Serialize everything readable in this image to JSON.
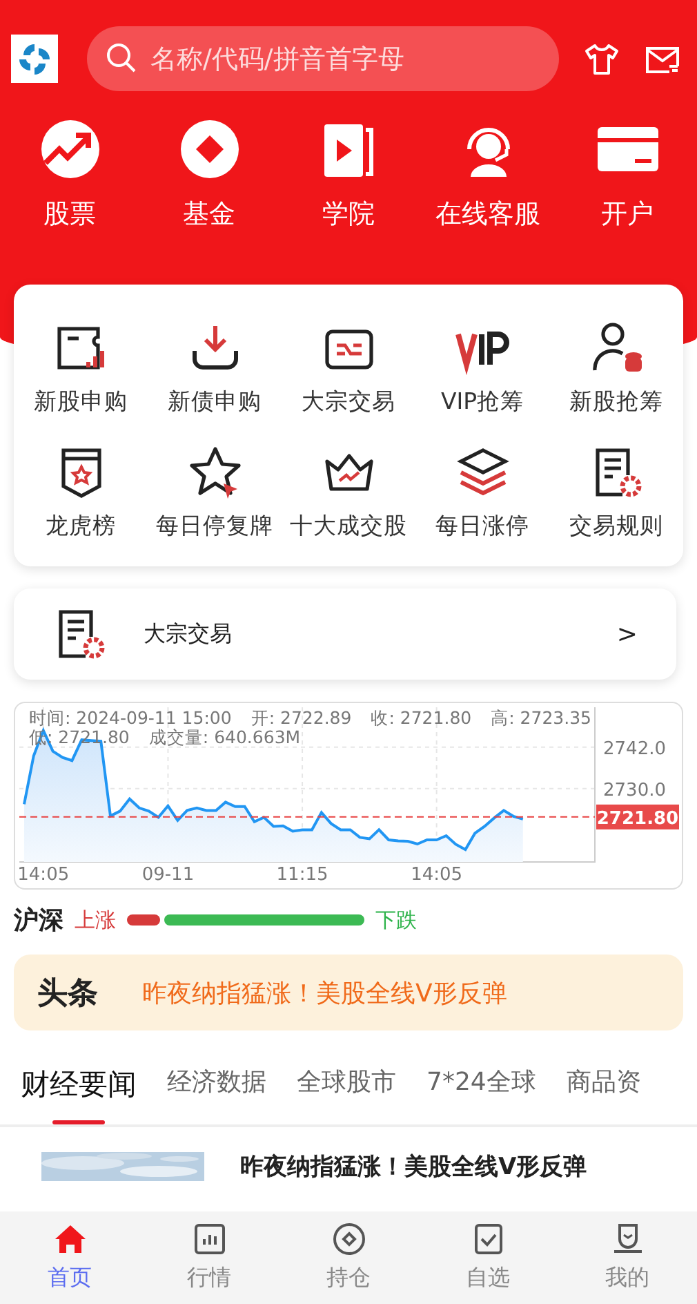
{
  "header": {
    "search": {
      "placeholder": "名称/代码/拼音首字母"
    }
  },
  "quick_links": [
    {
      "kind": "stock",
      "label": "股票"
    },
    {
      "kind": "fund",
      "label": "基金"
    },
    {
      "kind": "academy",
      "label": "学院"
    },
    {
      "kind": "service",
      "label": "在线客服"
    },
    {
      "kind": "account",
      "label": "开户"
    }
  ],
  "services": [
    {
      "kind": "ticket",
      "label": "新股申购"
    },
    {
      "kind": "download",
      "label": "新债申购"
    },
    {
      "kind": "swap",
      "label": "大宗交易"
    },
    {
      "kind": "vip",
      "label": "VIP抢筹"
    },
    {
      "kind": "person",
      "label": "新股抢筹"
    },
    {
      "kind": "shield",
      "label": "龙虎榜"
    },
    {
      "kind": "star",
      "label": "每日停复牌"
    },
    {
      "kind": "crown",
      "label": "十大成交股"
    },
    {
      "kind": "layers",
      "label": "每日涨停"
    },
    {
      "kind": "doc",
      "label": "交易规则"
    }
  ],
  "feature_row": {
    "label": "大宗交易",
    "arrow": ">"
  },
  "chart": {
    "info": [
      "时间: 2024-09-11 15:00",
      "开: 2722.89",
      "收: 2721.80",
      "高: 2723.35",
      "低: 2721.80",
      "成交量: 640.663M"
    ],
    "chart_data": {
      "type": "area",
      "grid": true,
      "ylim": [
        2708.8,
        2753.5
      ],
      "yticks": [
        {
          "value": 2742,
          "label": "2742.0"
        },
        {
          "value": 2730,
          "label": "2730.0"
        }
      ],
      "categories": [
        null,
        null,
        "14:05",
        null,
        null,
        null,
        null,
        null,
        null,
        null,
        null,
        null,
        null,
        null,
        null,
        "09-11",
        null,
        null,
        null,
        null,
        null,
        null,
        null,
        null,
        null,
        null,
        null,
        null,
        null,
        "11:15",
        null,
        null,
        null,
        null,
        null,
        null,
        null,
        null,
        null,
        null,
        null,
        null,
        null,
        "14:05",
        null,
        null,
        null,
        null,
        null,
        null,
        null,
        null,
        null,
        null,
        null,
        null,
        null,
        null,
        null,
        null
      ],
      "series": [
        {
          "color": "#2196f3",
          "values": [
            2725.5,
            2739.5,
            2746.8,
            2740.8,
            2739,
            2738.1,
            2744.1,
            2743.9,
            2743.7,
            2722.1,
            2723.5,
            2727,
            2724.4,
            2723.5,
            2721.7,
            2725,
            2720.8,
            2723.7,
            2724.4,
            2723.7,
            2723.7,
            2726.1,
            2724.8,
            2724.8,
            2720.4,
            2721.7,
            2719.1,
            2719.2,
            2717.7,
            2718.1,
            2718.1,
            2723.1,
            2719.9,
            2718.1,
            2718.1,
            2715.9,
            2715.5,
            2718.1,
            2715.2,
            2714.9,
            2714.8,
            2714,
            2715.2,
            2715.2,
            2716.4,
            2713.9,
            2712.4,
            2717.1,
            2719.1,
            2721.5,
            2723.7,
            2722,
            2721.2,
            null,
            null,
            null,
            null,
            null,
            null,
            null
          ]
        }
      ],
      "ref_lines": [
        {
          "axis": "y",
          "value": 2721.8,
          "label": "2721.80"
        }
      ]
    }
  },
  "breadth": {
    "title": "沪深",
    "up_label": "上涨",
    "down_label": "下跌",
    "level": 0.14
  },
  "headline_banner": {
    "badge": "头条",
    "text": "昨夜纳指猛涨！美股全线V形反弹"
  },
  "news_tabs": [
    {
      "label": "财经要闻",
      "selected": true
    },
    {
      "label": "经济数据",
      "selected": false
    },
    {
      "label": "全球股市",
      "selected": false
    },
    {
      "label": "7*24全球",
      "selected": false
    },
    {
      "label": "商品资",
      "selected": false
    }
  ],
  "news": [
    {
      "kind": "picture",
      "title": "昨夜纳指猛涨！美股全线V形反弹"
    }
  ],
  "bottom_nav": [
    {
      "kind": "home",
      "label": "首页",
      "selected": true
    },
    {
      "kind": "market",
      "label": "行情",
      "selected": false
    },
    {
      "kind": "holdings",
      "label": "持仓",
      "selected": false
    },
    {
      "kind": "watchlist",
      "label": "自选",
      "selected": false
    },
    {
      "kind": "profile",
      "label": "我的",
      "selected": false
    }
  ]
}
